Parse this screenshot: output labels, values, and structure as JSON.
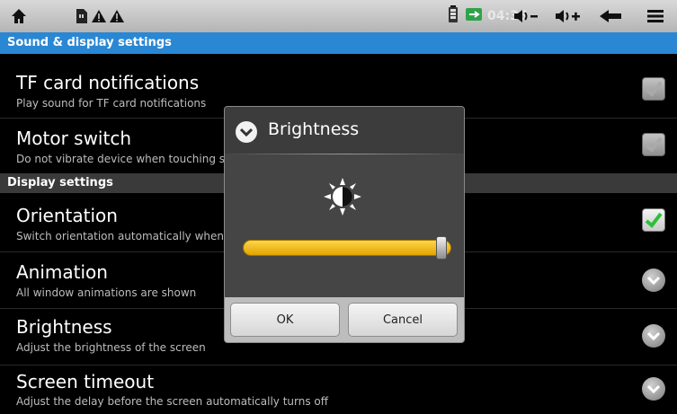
{
  "status_bar": {
    "time": "04:36",
    "icons": [
      "home-icon",
      "sd-card-icon",
      "warning-icon",
      "warning-icon",
      "battery-icon",
      "usb-icon",
      "volume-down-icon",
      "volume-up-icon",
      "back-icon",
      "menu-icon"
    ]
  },
  "title_bar": {
    "title": "Sound & display settings"
  },
  "settings": [
    {
      "title": "TF card notifications",
      "subtitle": "Play sound for TF card notifications",
      "control": "checkbox",
      "checked": true,
      "enabled": false
    },
    {
      "title": "Motor switch",
      "subtitle": "Do not vibrate device when touching screen",
      "control": "checkbox",
      "checked": true,
      "enabled": false
    },
    {
      "title": "Orientation",
      "subtitle": "Switch orientation automatically when rotating device",
      "control": "checkbox",
      "checked": true,
      "enabled": true
    },
    {
      "title": "Animation",
      "subtitle": "All window animations are shown",
      "control": "dropdown"
    },
    {
      "title": "Brightness",
      "subtitle": "Adjust the brightness of the screen",
      "control": "dropdown"
    },
    {
      "title": "Screen timeout",
      "subtitle": "Adjust the delay before the screen automatically turns off",
      "control": "dropdown"
    }
  ],
  "section_header": "Display settings",
  "dialog": {
    "title": "Brightness",
    "slider_value": 0.98,
    "ok_label": "OK",
    "cancel_label": "Cancel"
  },
  "colors": {
    "accent_blue": "#2a87d4",
    "slider_yellow": "#f5c000",
    "check_green": "#2fbf3a"
  }
}
